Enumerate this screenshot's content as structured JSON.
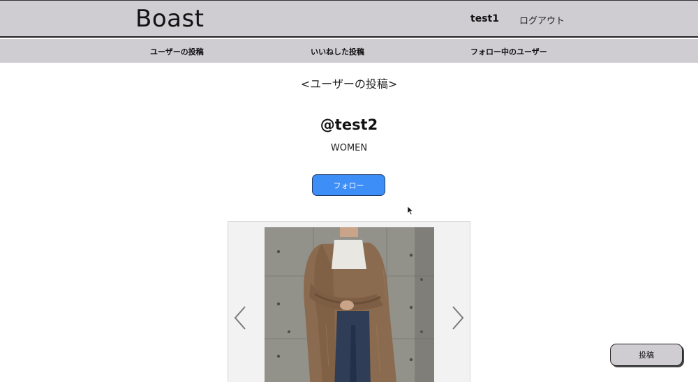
{
  "header": {
    "logo": "Boast",
    "username": "test1",
    "logout_label": "ログアウト"
  },
  "nav": {
    "items": [
      {
        "label": "ユーザーの投稿"
      },
      {
        "label": "いいねした投稿"
      },
      {
        "label": "フォロー中のユーザー"
      }
    ]
  },
  "main": {
    "section_title": "<ユーザーの投稿>",
    "profile": {
      "username": "@test2",
      "category": "WOMEN"
    },
    "follow_label": "フォロー"
  },
  "carousel": {
    "prev_icon": "chevron-left-icon",
    "next_icon": "chevron-right-icon"
  },
  "post_button_label": "投稿",
  "colors": {
    "header_bg": "#cfcdd2",
    "accent": "#3d8ef7",
    "carousel_bg": "#f2f2f2"
  }
}
